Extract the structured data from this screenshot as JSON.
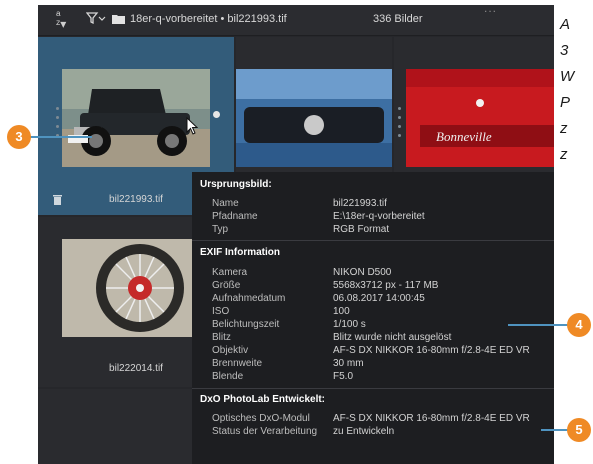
{
  "toolbar": {
    "sort_icon": "sort-az-icon",
    "filter_icon": "filter-icon",
    "folder_icon": "folder-icon",
    "path": "18er-q-vorbereitet • bil221993.tif",
    "count": "336 Bilder",
    "more": "..."
  },
  "thumbnails": [
    {
      "caption": "bil221993.tif",
      "selected": true
    },
    {
      "caption": "",
      "selected": false
    },
    {
      "caption": "",
      "selected": false
    },
    {
      "caption": "bil222014.tif",
      "selected": false
    }
  ],
  "tooltip": {
    "section1": {
      "title": "Ursprungsbild:",
      "rows": [
        {
          "key": "Name",
          "value": "bil221993.tif"
        },
        {
          "key": "Pfadname",
          "value": "E:\\18er-q-vorbereitet"
        },
        {
          "key": "Typ",
          "value": "RGB Format"
        }
      ]
    },
    "section2": {
      "title": "EXIF Information",
      "rows": [
        {
          "key": "Kamera",
          "value": "NIKON D500"
        },
        {
          "key": "Größe",
          "value": "5568x3712  px - 117 MB"
        },
        {
          "key": "Aufnahmedatum",
          "value": "06.08.2017 14:00:45"
        },
        {
          "key": "ISO",
          "value": "100"
        },
        {
          "key": "Belichtungszeit",
          "value": "1/100 s"
        },
        {
          "key": "Blitz",
          "value": "Blitz wurde nicht ausgelöst"
        },
        {
          "key": "Objektiv",
          "value": "AF-S DX NIKKOR 16-80mm f/2.8-4E ED VR"
        },
        {
          "key": "Brennweite",
          "value": "30  mm"
        },
        {
          "key": "Blende",
          "value": "F5.0"
        }
      ]
    },
    "section3": {
      "title": "DxO PhotoLab Entwickelt:",
      "rows": [
        {
          "key": "Optisches DxO-Modul",
          "value": "AF-S DX NIKKOR 16-80mm f/2.8-4E ED VR"
        },
        {
          "key": "Status der Verarbeitung",
          "value": "zu Entwickeln"
        }
      ]
    }
  },
  "callouts": {
    "c3": "3",
    "c4": "4",
    "c5": "5"
  },
  "right_margin_text": [
    "A",
    "3",
    "W",
    "P",
    "z",
    "z"
  ],
  "colors": {
    "callout": "#ef8a25",
    "callout_line": "#4f93bf",
    "selection": "#335c7a"
  }
}
